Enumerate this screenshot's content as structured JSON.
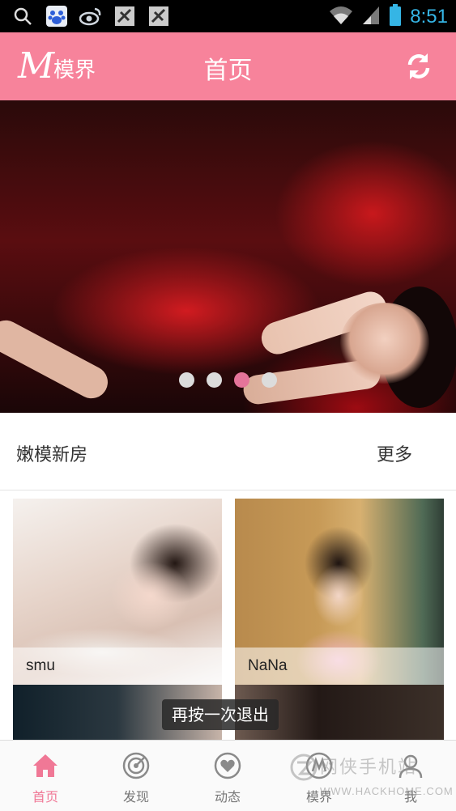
{
  "status_bar": {
    "time": "8:51",
    "icons": [
      "search-icon",
      "baidu-icon",
      "weibo-icon",
      "app-icon",
      "app-icon",
      "wifi-icon",
      "signal-icon",
      "battery-icon"
    ]
  },
  "header": {
    "logo_text": "模界",
    "logo_letter": "M",
    "title": "首页",
    "refresh_icon": "refresh-icon",
    "background_color": "#f7839b"
  },
  "banner": {
    "slide_count": 4,
    "active_index": 2
  },
  "section": {
    "title": "嫩模新房",
    "more": "更多"
  },
  "cards": [
    {
      "name": "smu"
    },
    {
      "name": "NaNa"
    },
    {
      "name": ""
    },
    {
      "name": ""
    }
  ],
  "toast": "再按一次退出",
  "bottom_nav": [
    {
      "label": "首页",
      "icon": "home-icon",
      "active": true
    },
    {
      "label": "发现",
      "icon": "radar-icon",
      "active": false
    },
    {
      "label": "动态",
      "icon": "heart-icon",
      "active": false
    },
    {
      "label": "模界",
      "icon": "model-icon",
      "active": false
    },
    {
      "label": "我",
      "icon": "user-icon",
      "active": false
    }
  ],
  "watermark": {
    "line1": "网侠手机站",
    "line2": "WWW.HACKHOME.COM"
  },
  "colors": {
    "accent": "#f7839b",
    "active_nav": "#f07896",
    "active_dot": "#e5749a"
  }
}
